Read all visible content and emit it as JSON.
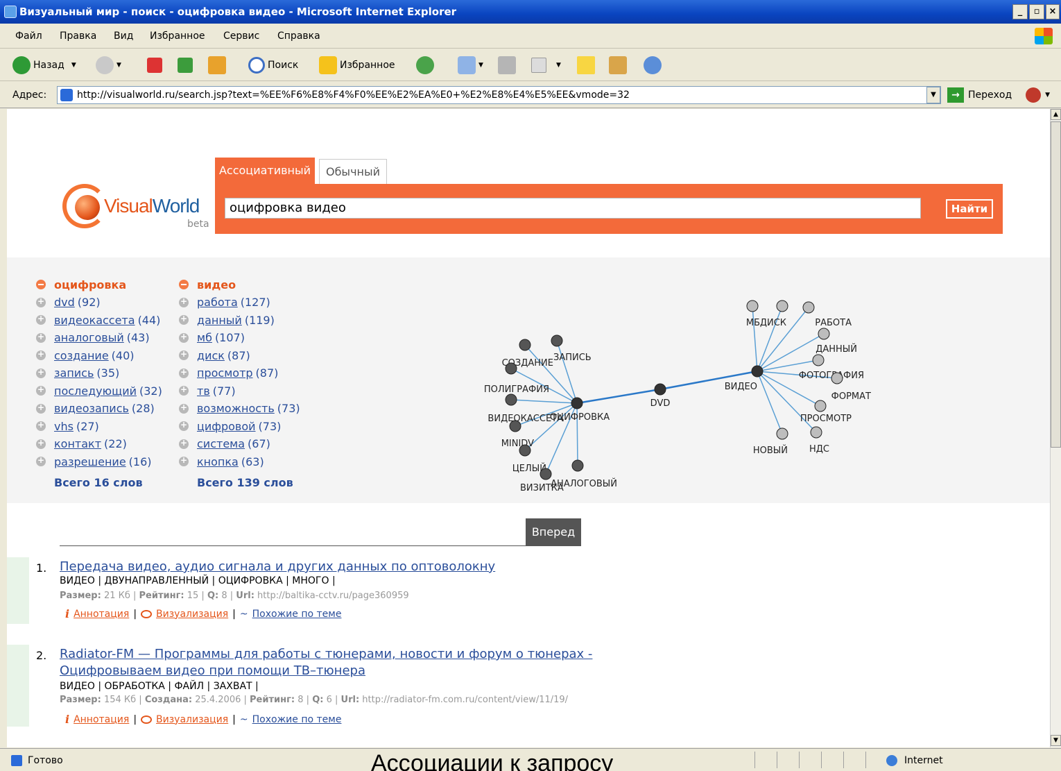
{
  "window": {
    "title": "Визуальный мир - поиск - оцифровка видео - Microsoft Internet Explorer",
    "min": "_",
    "max": "▫",
    "close": "×"
  },
  "menu": [
    "Файл",
    "Правка",
    "Вид",
    "Избранное",
    "Сервис",
    "Справка"
  ],
  "toolbar": {
    "back": "Назад",
    "search": "Поиск",
    "favorites": "Избранное"
  },
  "address": {
    "label": "Адрес:",
    "url": "http://visualworld.ru/search.jsp?text=%EE%F6%E8%F4%F0%EE%E2%EA%E0+%E2%E8%E4%E5%EE&vmode=32",
    "go": "Переход"
  },
  "logo": {
    "visual": "Visual",
    "world": "World",
    "beta": "beta"
  },
  "search": {
    "tab_assoc": "Ассоциативный",
    "tab_normal": "Обычный",
    "query": "оцифровка видео",
    "button": "Найти"
  },
  "columns": [
    {
      "head": "оцифровка",
      "items": [
        {
          "w": "dvd",
          "c": "(92)"
        },
        {
          "w": "видеокассета",
          "c": "(44)"
        },
        {
          "w": "аналоговый",
          "c": "(43)"
        },
        {
          "w": "создание",
          "c": "(40)"
        },
        {
          "w": "запись",
          "c": "(35)"
        },
        {
          "w": "последующий",
          "c": "(32)"
        },
        {
          "w": "видеозапись",
          "c": "(28)"
        },
        {
          "w": "vhs",
          "c": "(27)"
        },
        {
          "w": "контакт",
          "c": "(22)"
        },
        {
          "w": "разрешение",
          "c": "(16)"
        }
      ],
      "total": "Всего 16 слов"
    },
    {
      "head": "видео",
      "items": [
        {
          "w": "работа",
          "c": "(127)"
        },
        {
          "w": "данный",
          "c": "(119)"
        },
        {
          "w": "мб",
          "c": "(107)"
        },
        {
          "w": "диск",
          "c": "(87)"
        },
        {
          "w": "просмотр",
          "c": "(87)"
        },
        {
          "w": "тв",
          "c": "(77)"
        },
        {
          "w": "возможность",
          "c": "(73)"
        },
        {
          "w": "цифровой",
          "c": "(73)"
        },
        {
          "w": "система",
          "c": "(67)"
        },
        {
          "w": "кнопка",
          "c": "(63)"
        }
      ],
      "total": "Всего 139 слов"
    }
  ],
  "graph": {
    "hubs": [
      "ОЦИФРОВКА",
      "DVD",
      "ВИДЕО"
    ],
    "left_nodes": [
      "ЗАПИСЬ",
      "СОЗДАНИЕ",
      "ПОЛИГРАФИЯ",
      "ВИДЕОКАССЕТА",
      "MINIDV",
      "ЦЕЛЫЙ",
      "ВИЗИТКА",
      "АНАЛОГОВЫЙ"
    ],
    "right_nodes": [
      "МБ",
      "ДИСК",
      "РАБОТА",
      "ДАННЫЙ",
      "ФОТОГРАФИЯ",
      "ФОРМАТ",
      "ПРОСМОТР",
      "НДС",
      "НОВЫЙ"
    ]
  },
  "forward": "Вперед",
  "results": [
    {
      "num": "1.",
      "title": "Передача видео, аудио сигнала и других данных по оптоволокну",
      "tags": "ВИДЕО | ДВУНАПРАВЛЕННЫЙ | ОЦИФРОВКА | МНОГО |",
      "meta": {
        "size_l": "Размер:",
        "size": "21 Кб |",
        "rating_l": "Рейтинг:",
        "rating": "15 |",
        "q_l": "Q:",
        "q": "8 |",
        "url_l": "Url:",
        "url": "http://baltika-cctv.ru/page360959"
      }
    },
    {
      "num": "2.",
      "title": "Radiator-FM — Программы для работы с тюнерами, новости и форум о тюнерах - Оцифровываем видео при помощи ТВ–тюнера",
      "tags": "ВИДЕО | ОБРАБОТКА | ФАЙЛ | ЗАХВАТ |",
      "meta": {
        "size_l": "Размер:",
        "size": "154 Кб |",
        "created_l": "Создана:",
        "created": "25.4.2006 |",
        "rating_l": "Рейтинг:",
        "rating": "8 |",
        "q_l": "Q:",
        "q": "6 |",
        "url_l": "Url:",
        "url": "http://radiator-fm.com.ru/content/view/11/19/"
      }
    }
  ],
  "actions": {
    "annot": "Аннотация",
    "visual": "Визуализация",
    "similar": "Похожие по теме",
    "sep": "|"
  },
  "status": {
    "text": "Готово",
    "zone": "Internet"
  },
  "caption": "Ассоциации к запросу"
}
